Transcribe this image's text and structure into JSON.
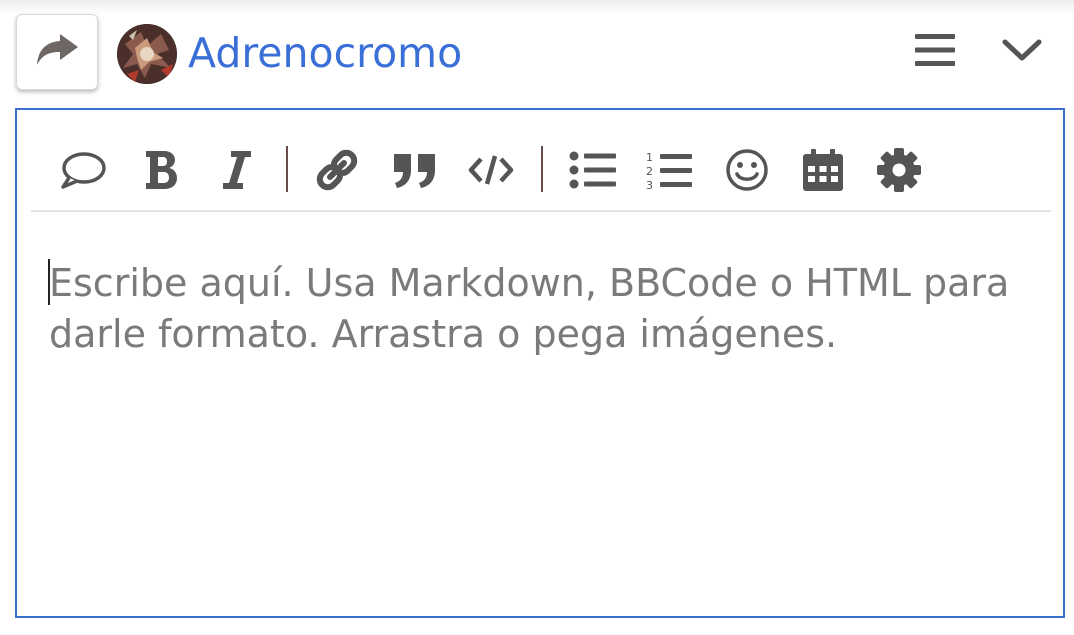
{
  "header": {
    "username": "Adrenocromo",
    "username_color": "#3a6fd8"
  },
  "icons": {
    "reply": "reply-share-icon",
    "menu": "hamburger-menu-icon",
    "collapse": "chevron-down-icon"
  },
  "toolbar": {
    "items": [
      {
        "icon": "speech-bubble-icon"
      },
      {
        "icon": "bold-icon"
      },
      {
        "icon": "italic-icon"
      },
      {
        "icon": "link-icon"
      },
      {
        "icon": "quote-icon"
      },
      {
        "icon": "code-icon"
      },
      {
        "icon": "bulleted-list-icon"
      },
      {
        "icon": "numbered-list-icon"
      },
      {
        "icon": "emoji-icon"
      },
      {
        "icon": "calendar-icon"
      },
      {
        "icon": "gear-icon"
      }
    ],
    "icon_color": "#555555"
  },
  "editor": {
    "placeholder": "Escribe aquí. Usa Markdown, BBCode o HTML para darle formato. Arrastra o pega imágenes.",
    "value": "",
    "border_color": "#3d6fd1"
  }
}
